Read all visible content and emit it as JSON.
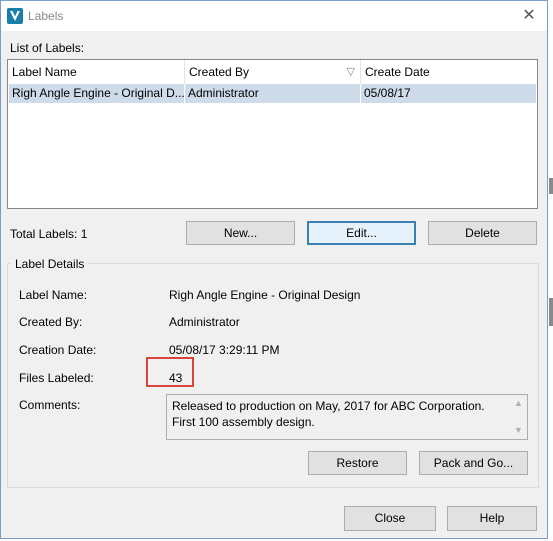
{
  "window": {
    "title": "Labels",
    "app_icon": "vault-v-icon",
    "close_glyph": "✕"
  },
  "list": {
    "heading": "List of Labels:",
    "columns": [
      "Label Name",
      "Created By",
      "Create Date"
    ],
    "sort_glyph": "▽",
    "rows": [
      {
        "label_name": "Righ Angle Engine - Original D...",
        "created_by": "Administrator",
        "create_date": "05/08/17"
      }
    ]
  },
  "toolbar": {
    "total_labels": "Total Labels: 1",
    "new_label": "New...",
    "edit_label": "Edit...",
    "delete_label": "Delete"
  },
  "details": {
    "group_title": "Label Details",
    "label_name_caption": "Label Name:",
    "label_name_value": "Righ Angle Engine - Original Design",
    "created_by_caption": "Created By:",
    "created_by_value": "Administrator",
    "creation_date_caption": "Creation Date:",
    "creation_date_value": "05/08/17 3:29:11 PM",
    "files_labeled_caption": "Files Labeled:",
    "files_labeled_value": "43",
    "comments_caption": "Comments:",
    "comments_line1": "Released to production on May, 2017 for ABC Corporation.",
    "comments_line2": "First 100 assembly design.",
    "restore_label": "Restore",
    "pack_and_go_label": "Pack and Go..."
  },
  "footer": {
    "close_label": "Close",
    "help_label": "Help"
  },
  "colors": {
    "selection": "#cddbea",
    "highlight_border": "#d9453a",
    "focus_border": "#3c7fb1"
  }
}
